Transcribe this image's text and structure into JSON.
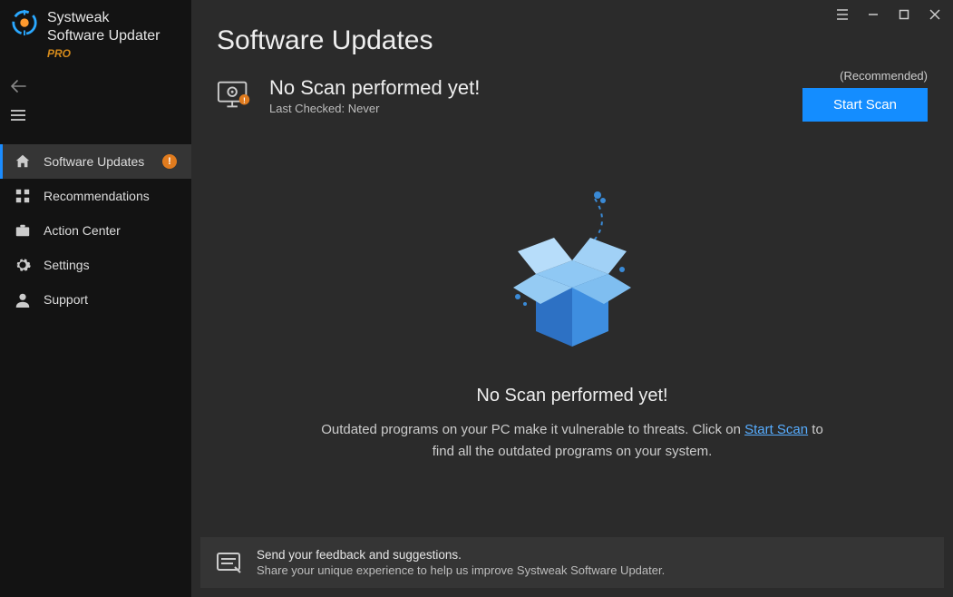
{
  "brand": {
    "company": "Systweak",
    "product": "Software Updater",
    "tier": "PRO"
  },
  "sidebar": {
    "items": [
      {
        "label": "Software Updates",
        "icon": "home-icon",
        "active": true,
        "badge": "!"
      },
      {
        "label": "Recommendations",
        "icon": "grid-icon",
        "active": false
      },
      {
        "label": "Action Center",
        "icon": "briefcase-icon",
        "active": false
      },
      {
        "label": "Settings",
        "icon": "gear-icon",
        "active": false
      },
      {
        "label": "Support",
        "icon": "support-icon",
        "active": false
      }
    ]
  },
  "page": {
    "title": "Software Updates",
    "scan": {
      "heading": "No Scan performed yet!",
      "last_checked_label": "Last Checked:",
      "last_checked_value": "Never",
      "recommended": "(Recommended)",
      "button": "Start Scan"
    },
    "center": {
      "title": "No Scan performed yet!",
      "text_before": "Outdated programs on your PC make it vulnerable to threats. Click on ",
      "link": "Start Scan",
      "text_after": " to find all the outdated programs on your system."
    },
    "feedback": {
      "title": "Send your feedback and suggestions.",
      "sub": "Share your unique experience to help us improve Systweak Software Updater."
    }
  }
}
